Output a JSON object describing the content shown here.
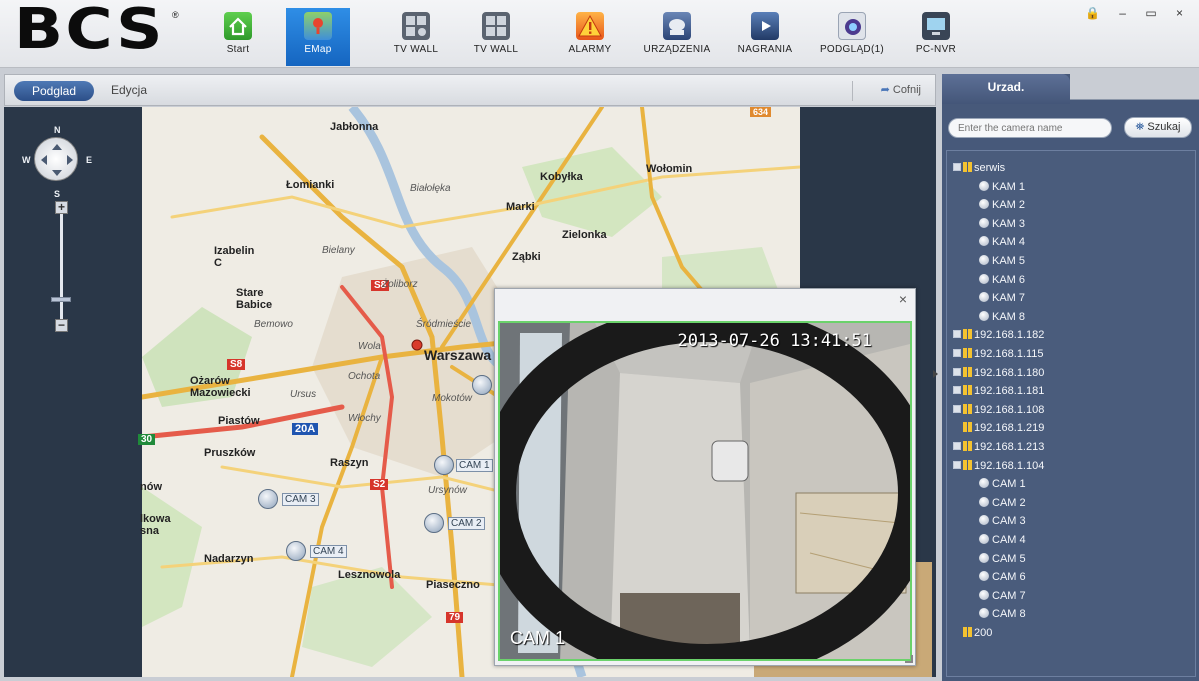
{
  "app": {
    "logo_text": "BCS",
    "logo_mark": "®"
  },
  "nav": {
    "items": [
      {
        "label": "Start",
        "icon": "home-icon"
      },
      {
        "label": "EMap",
        "icon": "map-icon",
        "active": true
      },
      {
        "label": "TV WALL",
        "icon": "tv-wall-config-icon"
      },
      {
        "label": "TV WALL",
        "icon": "tv-wall-icon"
      },
      {
        "label": "ALARMY",
        "icon": "alarm-icon"
      },
      {
        "label": "URZĄDZENIA",
        "icon": "devices-icon"
      },
      {
        "label": "NAGRANIA",
        "icon": "recordings-icon"
      },
      {
        "label": "PODGLĄD(1)",
        "icon": "preview-icon"
      },
      {
        "label": "PC-NVR",
        "icon": "pc-nvr-icon"
      }
    ],
    "window_controls": "🔒 – ▭ ×"
  },
  "toolbar": {
    "tab_active": "Podglad",
    "tab_inactive": "Edycja",
    "back_label": "Cofnij",
    "back_icon": "undo-arrow-icon"
  },
  "map": {
    "compass": {
      "n": "N",
      "s": "S",
      "e": "E",
      "w": "W"
    },
    "zoom_plus": "+",
    "zoom_minus": "−",
    "labels": {
      "jablonna": "Jabłonna",
      "lomianki": "Łomianki",
      "bialoleka": "Białołęka",
      "kobylka": "Kobyłka",
      "wolomin": "Wołomin",
      "marki": "Marki",
      "zielonka": "Zielonka",
      "izabelin": "Izabelin C",
      "bielany": "Bielany",
      "zabki": "Ząbki",
      "zoliborz": "Żoliborz",
      "stare_babice": "Stare Babice",
      "bemowo": "Bemowo",
      "srodmiescie": "Śródmieście",
      "wola": "Wola",
      "warszawa": "Warszawa",
      "ozarow": "Ożarów Mazowiecki",
      "ochota": "Ochota",
      "ursus": "Ursus",
      "mokotow": "Mokotów",
      "piastow": "Piastów",
      "wlochy": "Włochy",
      "pruszkow": "Pruszków",
      "raszyn": "Raszyn",
      "ursynow": "Ursynów",
      "nadarzyn": "Nadarzyn",
      "lesznowola": "Lesznowola",
      "piaseczno": "Piaseczno",
      "now": "nów",
      "kowa": "lkowa sna",
      "r20a": "20A",
      "s8a": "S8",
      "s8b": "S8",
      "s2": "S2",
      "r79": "79",
      "r634": "634",
      "r30": "30"
    },
    "cameras": [
      "CAM 1",
      "CAM 2",
      "CAM 3",
      "CAM 4"
    ]
  },
  "popup": {
    "close": "×",
    "timestamp": "2013-07-26 13:41:51",
    "cam_label": "CAM 1"
  },
  "right_panel": {
    "tab": "Urzad.",
    "search_placeholder": "Enter the camera name",
    "search_button": "Szukaj",
    "tree": [
      {
        "level": 0,
        "type": "group",
        "label": "serwis",
        "expanded": true
      },
      {
        "level": 1,
        "type": "cam",
        "label": "KAM 1"
      },
      {
        "level": 1,
        "type": "cam",
        "label": "KAM 2"
      },
      {
        "level": 1,
        "type": "cam",
        "label": "KAM 3"
      },
      {
        "level": 1,
        "type": "cam",
        "label": "KAM 4"
      },
      {
        "level": 1,
        "type": "cam",
        "label": "KAM 5"
      },
      {
        "level": 1,
        "type": "cam",
        "label": "KAM 6"
      },
      {
        "level": 1,
        "type": "cam",
        "label": "KAM 7"
      },
      {
        "level": 1,
        "type": "cam",
        "label": "KAM 8"
      },
      {
        "level": 0,
        "type": "group",
        "label": "192.168.1.182",
        "expanded": false
      },
      {
        "level": 0,
        "type": "group",
        "label": "192.168.1.115",
        "expanded": false
      },
      {
        "level": 0,
        "type": "group",
        "label": "192.168.1.180",
        "expanded": false
      },
      {
        "level": 0,
        "type": "group",
        "label": "192.168.1.181",
        "expanded": false
      },
      {
        "level": 0,
        "type": "group",
        "label": "192.168.1.108",
        "expanded": false
      },
      {
        "level": 0,
        "type": "device",
        "label": "192.168.1.219"
      },
      {
        "level": 0,
        "type": "group",
        "label": "192.168.1.213",
        "expanded": false
      },
      {
        "level": 0,
        "type": "group",
        "label": "192.168.1.104",
        "expanded": true
      },
      {
        "level": 1,
        "type": "cam",
        "label": "CAM 1"
      },
      {
        "level": 1,
        "type": "cam",
        "label": "CAM 2"
      },
      {
        "level": 1,
        "type": "cam",
        "label": "CAM 3"
      },
      {
        "level": 1,
        "type": "cam",
        "label": "CAM 4"
      },
      {
        "level": 1,
        "type": "cam",
        "label": "CAM 5"
      },
      {
        "level": 1,
        "type": "cam",
        "label": "CAM 6"
      },
      {
        "level": 1,
        "type": "cam",
        "label": "CAM 7"
      },
      {
        "level": 1,
        "type": "cam",
        "label": "CAM 8"
      },
      {
        "level": 0,
        "type": "device",
        "label": "200"
      }
    ]
  }
}
